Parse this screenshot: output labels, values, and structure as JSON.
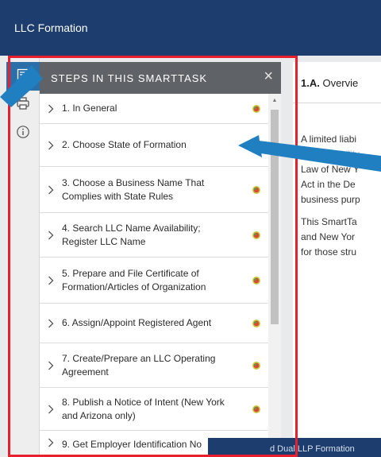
{
  "app": {
    "title": "LLC Formation"
  },
  "panel": {
    "title": "STEPS IN THIS SMARTTASK",
    "close_glyph": "×",
    "steps": [
      {
        "label": "1. In General"
      },
      {
        "label": "2. Choose State of Formation"
      },
      {
        "label": "3. Choose a Business Name That Complies with State Rules"
      },
      {
        "label": "4. Search LLC Name Availability; Register LLC Name"
      },
      {
        "label": "5. Prepare and File Certificate of Formation/Articles of Organization"
      },
      {
        "label": "6. Assign/Appoint Registered Agent"
      },
      {
        "label": "7. Create/Prepare an LLC Operating Agreement"
      },
      {
        "label": "8. Publish a Notice of Intent (New York and Arizona only)"
      },
      {
        "label": "9. Get Employer Identification No"
      }
    ]
  },
  "content": {
    "section_number": "1.A.",
    "section_title": " Overvie",
    "para1": [
      "A limited liabi",
      "limited liability",
      "Law of New Y",
      "Act in the De",
      "business purp"
    ],
    "para2": [
      "This SmartTa",
      "and New Yor",
      "for those stru"
    ]
  },
  "bottom_bar": {
    "text": "d Dual LLP Formation"
  },
  "colors": {
    "header_bg": "#1c3d6e",
    "panel_head_bg": "#5f6367",
    "highlight": "#e8202e",
    "callout": "#1f7fc0",
    "rail_active": "#2a6fa8"
  },
  "icons": {
    "rail": [
      "list-icon",
      "print-icon",
      "info-icon"
    ],
    "step": [
      "chevron-right-icon",
      "status-dot-icon"
    ]
  }
}
